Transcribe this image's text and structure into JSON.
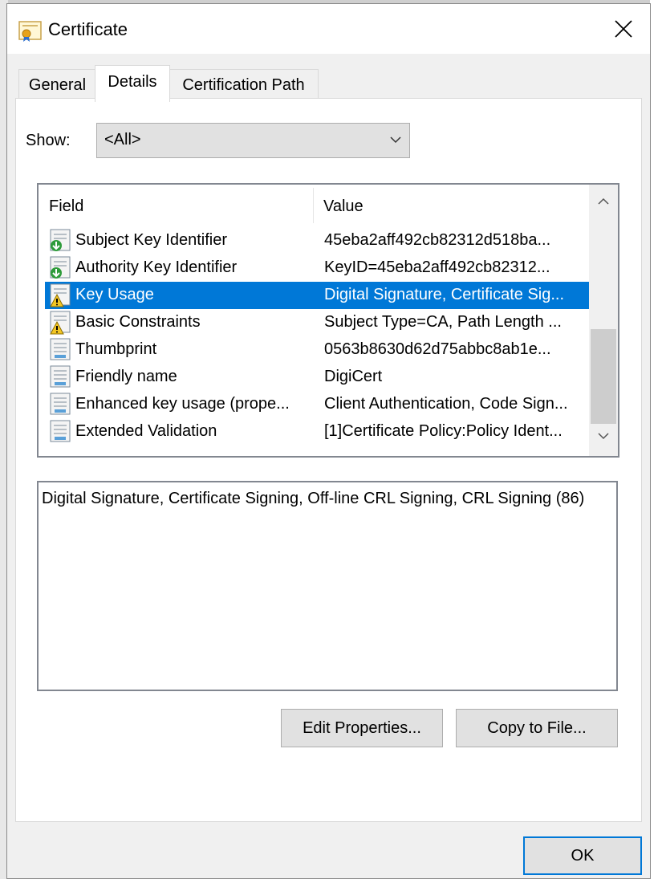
{
  "window": {
    "title": "Certificate"
  },
  "tabs": [
    {
      "label": "General"
    },
    {
      "label": "Details"
    },
    {
      "label": "Certification Path"
    }
  ],
  "show": {
    "label": "Show:",
    "selected": "<All>"
  },
  "list": {
    "columns": {
      "field": "Field",
      "value": "Value"
    },
    "rows": [
      {
        "field": "Subject Key Identifier",
        "value": "45eba2aff492cb82312d518ba...",
        "icon": "cert-green-arrow-icon"
      },
      {
        "field": "Authority Key Identifier",
        "value": "KeyID=45eba2aff492cb82312...",
        "icon": "cert-green-arrow-icon"
      },
      {
        "field": "Key Usage",
        "value": "Digital Signature, Certificate Sig...",
        "icon": "cert-warning-icon",
        "selected": true
      },
      {
        "field": "Basic Constraints",
        "value": "Subject Type=CA, Path Length ...",
        "icon": "cert-warning-icon"
      },
      {
        "field": "Thumbprint",
        "value": "0563b8630d62d75abbc8ab1e...",
        "icon": "cert-doc-icon"
      },
      {
        "field": "Friendly name",
        "value": "DigiCert",
        "icon": "cert-doc-icon"
      },
      {
        "field": "Enhanced key usage (prope...",
        "value": "Client Authentication, Code Sign...",
        "icon": "cert-doc-icon"
      },
      {
        "field": "Extended Validation",
        "value": "[1]Certificate Policy:Policy Ident...",
        "icon": "cert-doc-icon"
      }
    ]
  },
  "details": {
    "text": "Digital Signature, Certificate Signing, Off-line CRL Signing, CRL Signing (86)"
  },
  "buttons": {
    "edit_properties": "Edit Properties...",
    "copy_to_file": "Copy to File...",
    "ok": "OK"
  },
  "colors": {
    "selection": "#0078d7",
    "button_face": "#e1e1e1"
  }
}
